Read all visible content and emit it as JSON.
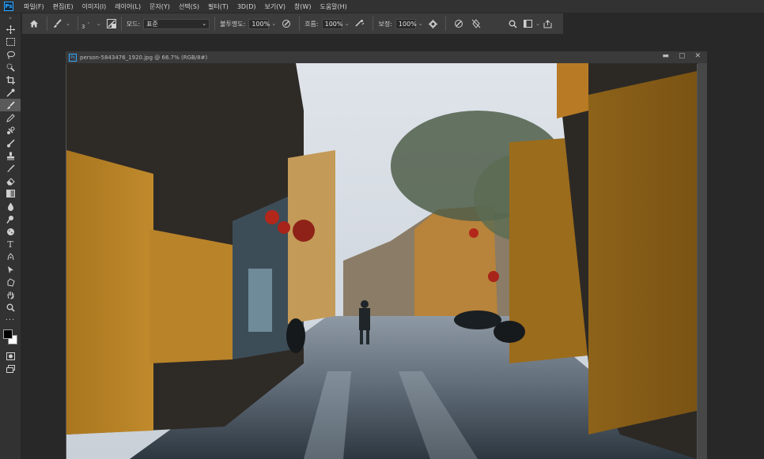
{
  "menu": {
    "logo": "Ps",
    "items": [
      "파일(F)",
      "편집(E)",
      "이미지(I)",
      "레이어(L)",
      "문자(Y)",
      "선택(S)",
      "필터(T)",
      "3D(D)",
      "보기(V)",
      "창(W)",
      "도움말(H)"
    ]
  },
  "options": {
    "brush_size": "3",
    "mode_label": "모드:",
    "mode_value": "표준",
    "opacity_label": "불투명도:",
    "opacity_value": "100%",
    "flow_label": "흐름:",
    "flow_value": "100%",
    "smoothing_label": "보정:",
    "smoothing_value": "100%"
  },
  "document": {
    "title": "person-5843476_1920.jpg @ 66.7% (RGB/8#)"
  },
  "colors": {
    "accent": "#31a8ff",
    "foreground": "#000000",
    "background": "#ffffff"
  }
}
